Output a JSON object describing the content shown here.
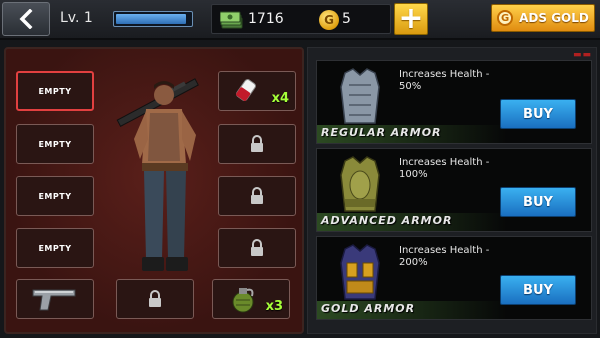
{
  "topbar": {
    "level": "Lv. 1",
    "xp_progress": 0.95,
    "cash": "1716",
    "gold_symbol": "G",
    "gold": "5",
    "add_label": "+",
    "ads_gold_label": "ADS GOLD",
    "ads_gold_symbol": "G"
  },
  "equipment": {
    "slots": [
      {
        "label": "EMPTY",
        "selected": true
      },
      {
        "label": "EMPTY"
      },
      {
        "label": "EMPTY"
      },
      {
        "label": "EMPTY"
      }
    ],
    "medkit_count": "x4",
    "grenade_count": "x3"
  },
  "shop": {
    "items": [
      {
        "name": "REGULAR ARMOR",
        "desc": "Increases Health - 50%",
        "buy": "BUY",
        "color": "#8a97a6"
      },
      {
        "name": "ADVANCED ARMOR",
        "desc": "Increases Health - 100%",
        "buy": "BUY",
        "color": "#8a8a3a"
      },
      {
        "name": "GOLD ARMOR",
        "desc": "Increases Health - 200%",
        "buy": "BUY",
        "color": "#c08a1a"
      }
    ]
  }
}
